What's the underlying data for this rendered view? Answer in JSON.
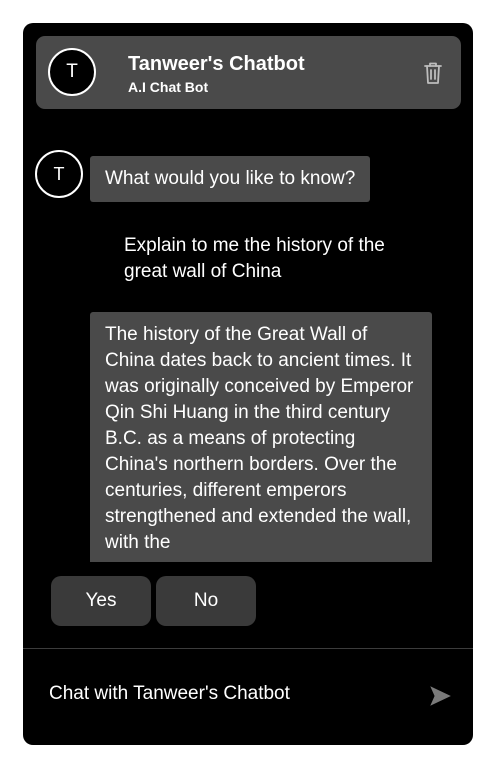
{
  "header": {
    "avatar_letter": "T",
    "title": "Tanweer's Chatbot",
    "subtitle": "A.I Chat Bot",
    "delete_icon": "trash-icon"
  },
  "messages": {
    "bot_avatar_letter": "T",
    "greeting": "What would you like to know?",
    "user_message": "Explain to me the history of the great wall of China",
    "bot_response": "The history of the Great Wall of China dates back to ancient times. It was originally conceived by Emperor Qin Shi Huang in the third century B.C. as a means of protecting China's northern borders. Over the centuries, different emperors strengthened and extended the wall, with the"
  },
  "quick_replies": {
    "yes_label": "Yes",
    "no_label": "No"
  },
  "composer": {
    "placeholder": "Chat with Tanweer's Chatbot",
    "send_icon": "send-icon"
  },
  "colors": {
    "window_bg": "#000000",
    "header_bg": "#4a4a4a",
    "bubble_bg": "#4a4a4a",
    "button_bg": "#3a3a3a",
    "text": "#ffffff",
    "send_icon": "#7a7a7a"
  }
}
